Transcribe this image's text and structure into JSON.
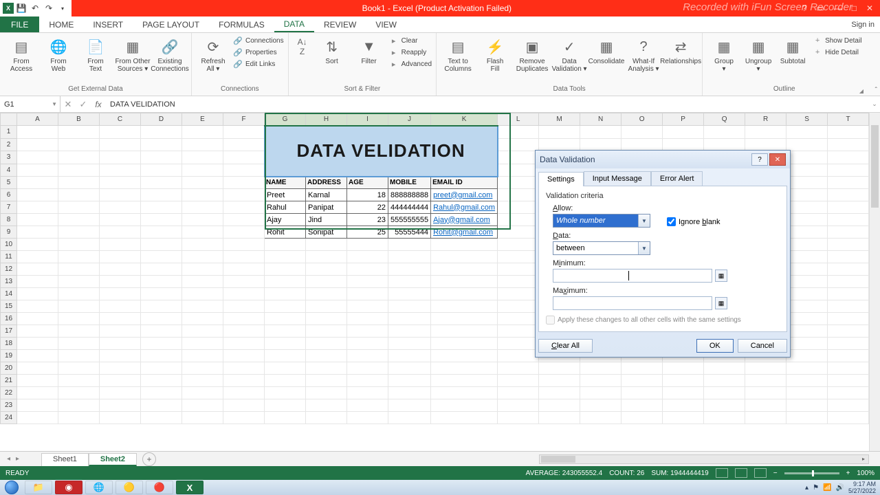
{
  "titlebar": {
    "app_title": "Book1 - Excel (Product Activation Failed)",
    "watermark": "Recorded with iFun Screen Recorder"
  },
  "ribbon": {
    "file": "FILE",
    "tabs": [
      "HOME",
      "INSERT",
      "PAGE LAYOUT",
      "FORMULAS",
      "DATA",
      "REVIEW",
      "VIEW"
    ],
    "active_tab": "DATA",
    "signin": "Sign in",
    "groups": {
      "get_external": {
        "label": "Get External Data",
        "buttons": [
          "From\nAccess",
          "From\nWeb",
          "From\nText",
          "From Other\nSources ▾",
          "Existing\nConnections"
        ]
      },
      "connections": {
        "label": "Connections",
        "refresh": "Refresh\nAll ▾",
        "items": [
          "Connections",
          "Properties",
          "Edit Links"
        ]
      },
      "sort_filter": {
        "label": "Sort & Filter",
        "sort": "Sort",
        "filter": "Filter",
        "items": [
          "Clear",
          "Reapply",
          "Advanced"
        ]
      },
      "data_tools": {
        "label": "Data Tools",
        "buttons": [
          "Text to\nColumns",
          "Flash\nFill",
          "Remove\nDuplicates",
          "Data\nValidation ▾",
          "Consolidate",
          "What-If\nAnalysis ▾",
          "Relationships"
        ]
      },
      "outline": {
        "label": "Outline",
        "buttons": [
          "Group\n▾",
          "Ungroup\n▾",
          "Subtotal"
        ],
        "items": [
          "Show Detail",
          "Hide Detail"
        ]
      }
    }
  },
  "formula_bar": {
    "name_box": "G1",
    "formula": "DATA VELIDATION"
  },
  "columns": [
    "A",
    "B",
    "C",
    "D",
    "E",
    "F",
    "G",
    "H",
    "I",
    "J",
    "K",
    "L",
    "M",
    "N",
    "O",
    "P",
    "Q",
    "R",
    "S",
    "T"
  ],
  "selected_cols": [
    "G",
    "H",
    "I",
    "J",
    "K"
  ],
  "sheet_title": "DATA VELIDATION",
  "table": {
    "headers": [
      "NAME",
      "ADDRESS",
      "AGE",
      "MOBILE",
      "EMAIL ID"
    ],
    "rows": [
      {
        "name": "Preet",
        "address": "Karnal",
        "age": "18",
        "mobile": "888888888",
        "email": "preet@gmail.com"
      },
      {
        "name": "Rahul",
        "address": "Panipat",
        "age": "22",
        "mobile": "444444444",
        "email": "Rahul@gmail.com"
      },
      {
        "name": "Ajay",
        "address": "Jind",
        "age": "23",
        "mobile": "555555555",
        "email": "Ajay@gmail.com"
      },
      {
        "name": "Rohit",
        "address": "Sonipat",
        "age": "25",
        "mobile": "55555444",
        "email": "Rohit@gmail.com"
      }
    ]
  },
  "dialog": {
    "title": "Data Validation",
    "tabs": [
      "Settings",
      "Input Message",
      "Error Alert"
    ],
    "active_tab": "Settings",
    "section": "Validation criteria",
    "allow_label": "Allow:",
    "allow_value": "Whole number",
    "ignore_blank": "Ignore blank",
    "data_label": "Data:",
    "data_value": "between",
    "min_label": "Minimum:",
    "max_label": "Maximum:",
    "apply_label": "Apply these changes to all other cells with the same settings",
    "clear": "Clear All",
    "ok": "OK",
    "cancel": "Cancel"
  },
  "sheets": {
    "items": [
      "Sheet1",
      "Sheet2"
    ],
    "active": "Sheet2"
  },
  "status": {
    "ready": "READY",
    "average": "AVERAGE: 243055552.4",
    "count": "COUNT: 26",
    "sum": "SUM: 1944444419",
    "zoom": "100%"
  },
  "tray": {
    "time": "9:17 AM",
    "date": "5/27/2022"
  }
}
